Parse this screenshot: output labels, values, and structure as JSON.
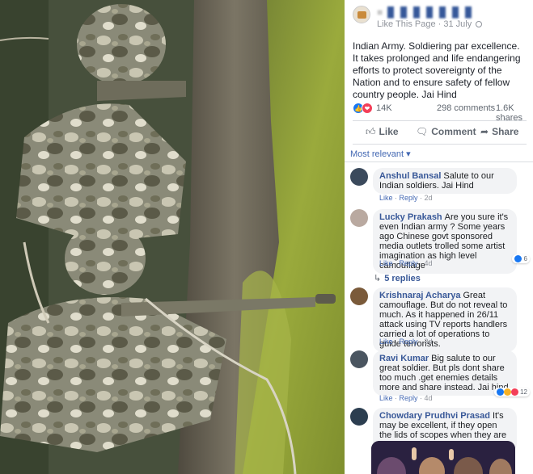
{
  "post": {
    "page_name": "▐▌▐▌▐▌▐▌▐▌▐▌▐▌",
    "meta": "Like This Page · 31 July",
    "text": "Indian Army. Soldiering par excellence. It takes prolonged and life endangering efforts to protect sovereignty of the Nation and to ensure safety of fellow country people. Jai Hind",
    "reaction_count": "14K",
    "comments_count": "298 comments",
    "shares_count": "1.6K shares"
  },
  "actions": {
    "like": "Like",
    "comment": "Comment",
    "share": "Share",
    "like_icon": "thumbs-up-icon",
    "comment_icon": "speech-bubble-icon",
    "share_icon": "share-arrow-icon"
  },
  "sort_label": "Most relevant ▾",
  "comments": [
    {
      "name": "Anshul Bansal",
      "text": "Salute to our Indian soldiers. Jai Hind",
      "like": "Like",
      "reply": "Reply",
      "time": "2d",
      "avatar_color": "#3b4a5c"
    },
    {
      "name": "Lucky Prakash",
      "text": "Are you sure it's even Indian army ? Some years ago Chinese govt sponsored media outlets trolled some artist imagination as high level camouflage",
      "like": "Like",
      "reply": "Reply",
      "time": "4d",
      "reaction_count": "6",
      "avatar_color": "#b9a9a0"
    },
    {
      "name": "Krishnaraj Acharya",
      "text": "Great camouflage. But do not reveal to much. As it happened in 26/11 attack using TV reports handlers carried a lot of operations to guide terrorists.",
      "like": "Like",
      "reply": "Reply",
      "time": "3d",
      "avatar_color": "#7a5a3a"
    },
    {
      "name": "Ravi Kumar",
      "text": "Big salute to our great soldier. But pls dont share too much .get enemies details more and share instead. Jai hind",
      "like": "Like",
      "reply": "Reply",
      "time": "4d",
      "reaction_count": "12",
      "avatar_color": "#4a5560"
    },
    {
      "name": "Chowdary Prudhvi Prasad",
      "text": "It's may be excellent, if they open the lids of scopes when they are looking into them.",
      "avatar_color": "#2c3e50"
    }
  ],
  "replies_label": "5 replies",
  "colors": {
    "link": "#385898",
    "bubble": "#f2f3f5",
    "like_blue": "#1877f2",
    "love_red": "#f33e58"
  }
}
